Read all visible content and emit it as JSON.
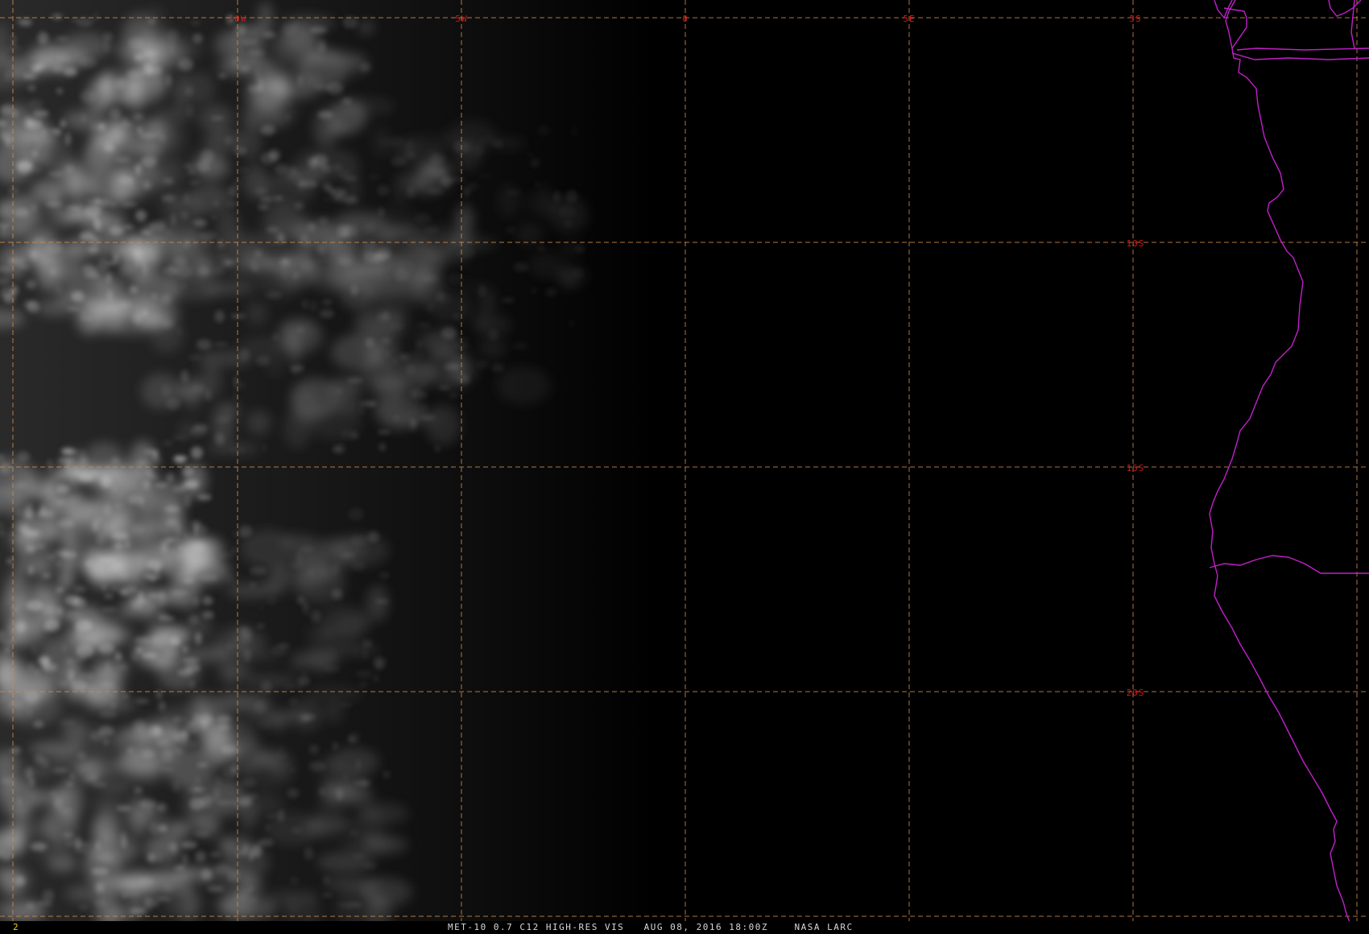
{
  "map": {
    "grid": {
      "longitude_labels": [
        "10W",
        "5W",
        "0",
        "5E"
      ],
      "latitude_labels": [
        "5S",
        "10S",
        "15S",
        "20S"
      ],
      "style": "dashed"
    },
    "colors": {
      "background": "#000000",
      "cloud": "#d8d8d8",
      "gridline": "#d08a4a",
      "grid_label": "#d01818",
      "coastline": "#c020c8",
      "status_text": "#d8d8d8",
      "frame_number": "#e8d020"
    },
    "boundaries": "coastline-and-borders"
  },
  "status": {
    "frame_number": "2",
    "caption": "MET-10 0.7 C12 HIGH-RES VIS   AUG 08, 2016 18:00Z    NASA LARC"
  }
}
